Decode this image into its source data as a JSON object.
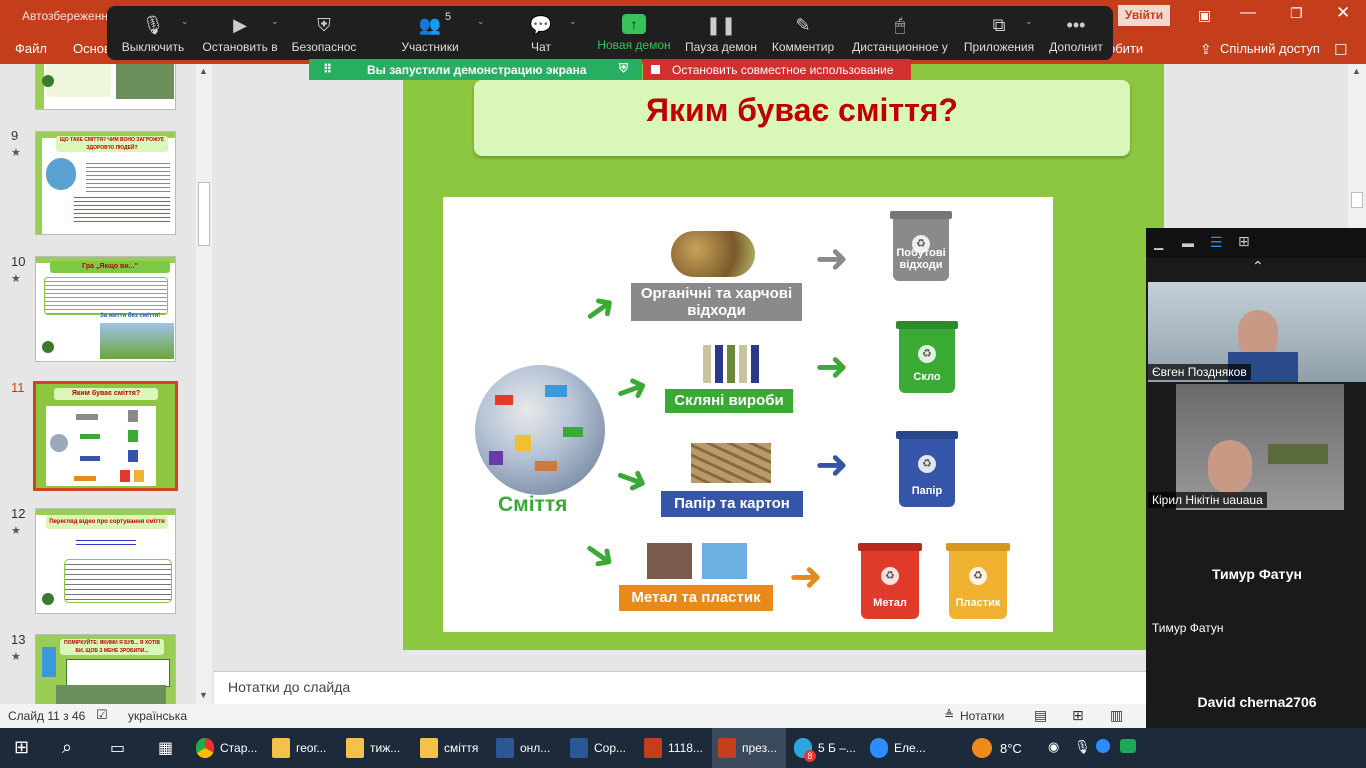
{
  "app": {
    "title_left": "Автозбереженн",
    "enter_button": "Увійти",
    "ribbon_file": "Файл",
    "ribbon_main": "Основ",
    "ribbon_right": "обити",
    "share": "Спільний доступ"
  },
  "zoom_toolbar": {
    "items": [
      {
        "label": "Выключить",
        "icon": "microphone-icon"
      },
      {
        "label": "Остановить в",
        "icon": "video-camera-icon"
      },
      {
        "label": "Безопаснос",
        "icon": "shield-icon"
      },
      {
        "label": "Участники",
        "icon": "participants-icon",
        "count": "5"
      },
      {
        "label": "Чат",
        "icon": "chat-icon"
      },
      {
        "label": "Новая демон",
        "icon": "share-screen-icon"
      },
      {
        "label": "Пауза демон",
        "icon": "pause-icon"
      },
      {
        "label": "Комментир",
        "icon": "pencil-icon"
      },
      {
        "label": "Дистанционное у",
        "icon": "mouse-icon"
      },
      {
        "label": "Приложения",
        "icon": "apps-icon"
      },
      {
        "label": "Дополнит",
        "icon": "more-icon"
      }
    ],
    "sharing_notice": "Вы запустили демонстрацию экрана",
    "stop_sharing": "Остановить совместное использование"
  },
  "thumbnails": [
    {
      "number": "9",
      "title": "ЩО ТАКЕ СМІТТЯ? ЧИМ ВОНО ЗАГРОЖУЄ ЗДОРОВ'Ю ЛЮДЕЙ?"
    },
    {
      "number": "10",
      "title": "Гра „Якщо ви...\"",
      "caption": "За життя без сміття!"
    },
    {
      "number": "11",
      "title": "Яким буває сміття?"
    },
    {
      "number": "12",
      "title": "Перегляд відео про сортування сміття"
    },
    {
      "number": "13",
      "title": "ПОМІРКУЙТЕ: ЯКИМИ Я БУВ... Я ХОТІВ БИ, ЩОБ З МЕНЕ ЗРОБИЛИ..."
    }
  ],
  "slide": {
    "title": "Яким буває сміття?",
    "waste_label": "Сміття",
    "categories": [
      {
        "label": "Органічні та харчові відходи",
        "bin": "Побутові відходи",
        "color": "#8a8a8a"
      },
      {
        "label": "Скляні вироби",
        "bin": "Скло",
        "color": "#3aaa35"
      },
      {
        "label": "Папір та картон",
        "bin": "Папір",
        "color": "#3556a8"
      },
      {
        "label": "Метал та пластик",
        "bin_a": "Метал",
        "bin_b": "Пластик",
        "color": "#e8891a"
      }
    ]
  },
  "notes": {
    "placeholder": "Нотатки до слайда"
  },
  "status": {
    "slide_counter": "Слайд 11 з 46",
    "language": "українська",
    "notes_button": "Нотатки"
  },
  "participants": [
    {
      "name": "Євген Поздняков"
    },
    {
      "name": "Кірил Нікітін uauaua"
    },
    {
      "name": "Тимур Фатун"
    },
    {
      "name": "David cherna2706"
    }
  ],
  "taskbar": {
    "items": [
      {
        "label": "Стар...",
        "icon": "chrome-icon"
      },
      {
        "label": "геог...",
        "icon": "folder-icon"
      },
      {
        "label": "тиж...",
        "icon": "folder-icon"
      },
      {
        "label": "сміття",
        "icon": "folder-icon"
      },
      {
        "label": "онл...",
        "icon": "word-icon"
      },
      {
        "label": "Сор...",
        "icon": "word-icon"
      },
      {
        "label": "1118...",
        "icon": "powerpoint-icon"
      },
      {
        "label": "през...",
        "icon": "powerpoint-icon"
      },
      {
        "label": "5 Б –...",
        "icon": "telegram-icon"
      },
      {
        "label": "Еле...",
        "icon": "zoom-icon"
      }
    ],
    "temperature": "8°C",
    "telegram_badge": "8"
  }
}
